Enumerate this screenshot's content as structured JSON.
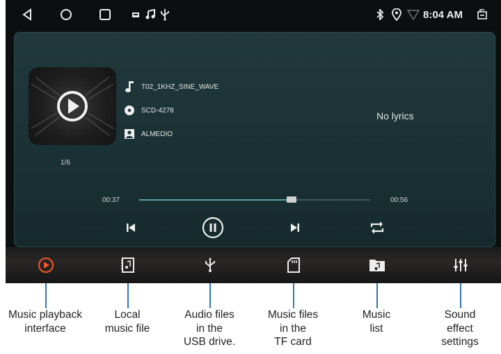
{
  "statusbar": {
    "nav_icons": [
      "back-icon",
      "home-icon",
      "recents-icon",
      "notification-icon",
      "music-note-icon",
      "usb-icon"
    ],
    "right_icons": [
      "bluetooth-icon",
      "location-icon",
      "wifi-icon",
      "screenshot-icon"
    ],
    "time": "8:04 AM"
  },
  "player": {
    "title": "T02_1KHZ_SINE_WAVE",
    "album": "SCD-4278",
    "artist": "ALMEDIO",
    "track_index": "1/6",
    "lyrics": "No lyrics",
    "elapsed": "00:37",
    "duration": "00:56",
    "progress": 0.66
  },
  "tabs": [
    {
      "icon": "play-circle-icon",
      "caption": "Music playback interface",
      "active": true
    },
    {
      "icon": "local-music-file-icon",
      "caption": "Local music file",
      "active": false
    },
    {
      "icon": "usb-icon",
      "caption": "Audio files in the USB drive.",
      "active": false
    },
    {
      "icon": "sd-card-icon",
      "caption": "Music files in the TF card",
      "active": false
    },
    {
      "icon": "music-folder-icon",
      "caption": "Music list",
      "active": false
    },
    {
      "icon": "equalizer-icon",
      "caption": "Sound effect settings",
      "active": false
    }
  ],
  "captions": {
    "c0": [
      "Music playback",
      "interface"
    ],
    "c1": [
      "Local",
      "music file"
    ],
    "c2": [
      "Audio files",
      "in the",
      "USB drive."
    ],
    "c3": [
      "Music files",
      "in the",
      "TF card"
    ],
    "c4": [
      "Music",
      "list"
    ],
    "c5": [
      "Sound",
      "effect",
      "settings"
    ]
  },
  "colors": {
    "accent": "#e8552a",
    "panel": "#1d3538",
    "leader": "#2f78b8"
  }
}
